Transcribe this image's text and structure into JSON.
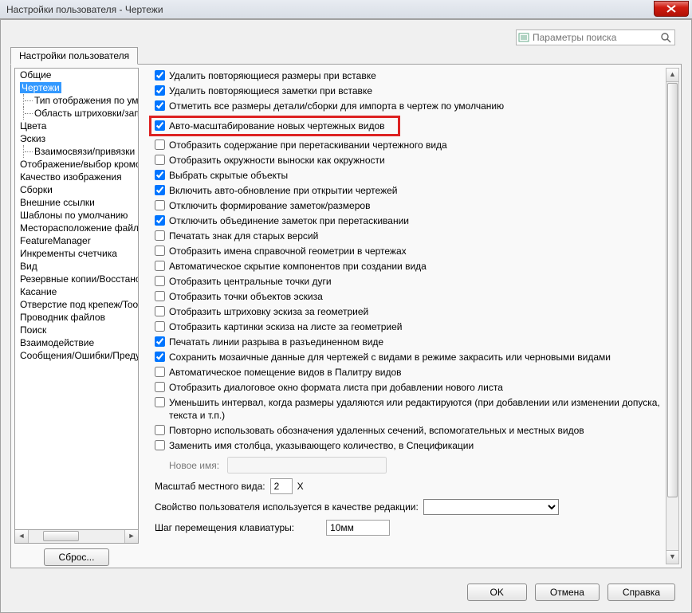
{
  "title": "Настройки пользователя - Чертежи",
  "search": {
    "placeholder": "Параметры поиска"
  },
  "tab": {
    "label": "Настройки пользователя"
  },
  "tree": {
    "items": [
      {
        "label": "Общие",
        "level": 0
      },
      {
        "label": "Чертежи",
        "level": 0,
        "selected": true
      },
      {
        "label": "Тип отображения по умо",
        "level": 1
      },
      {
        "label": "Область штриховки/зап",
        "level": 1
      },
      {
        "label": "Цвета",
        "level": 0
      },
      {
        "label": "Эскиз",
        "level": 0
      },
      {
        "label": "Взаимосвязи/привязки",
        "level": 1
      },
      {
        "label": "Отображение/выбор кромо",
        "level": 0
      },
      {
        "label": "Качество изображения",
        "level": 0
      },
      {
        "label": "Сборки",
        "level": 0
      },
      {
        "label": "Внешние ссылки",
        "level": 0
      },
      {
        "label": "Шаблоны по умолчанию",
        "level": 0
      },
      {
        "label": "Месторасположение файло",
        "level": 0
      },
      {
        "label": "FeatureManager",
        "level": 0
      },
      {
        "label": "Инкременты счетчика",
        "level": 0
      },
      {
        "label": "Вид",
        "level": 0
      },
      {
        "label": "Резервные копии/Восстано",
        "level": 0
      },
      {
        "label": "Касание",
        "level": 0
      },
      {
        "label": "Отверстие под крепеж/Tool",
        "level": 0
      },
      {
        "label": "Проводник файлов",
        "level": 0
      },
      {
        "label": "Поиск",
        "level": 0
      },
      {
        "label": "Взаимодействие",
        "level": 0
      },
      {
        "label": "Сообщения/Ошибки/Преду",
        "level": 0
      }
    ]
  },
  "reset_button": "Сброс...",
  "options": [
    {
      "checked": true,
      "label": "Удалить повторяющиеся размеры при вставке",
      "highlight": false
    },
    {
      "checked": true,
      "label": "Удалить повторяющиеся заметки при вставке",
      "highlight": false
    },
    {
      "checked": true,
      "label": "Отметить все размеры детали/сборки для импорта в чертеж по умолчанию",
      "highlight": false
    },
    {
      "checked": true,
      "label": "Авто-масштабирование новых чертежных видов",
      "highlight": true
    },
    {
      "checked": false,
      "label": "Отобразить содержание при перетаскивании чертежного вида",
      "highlight": false
    },
    {
      "checked": false,
      "label": "Отобразить окружности выноски как окружности",
      "highlight": false
    },
    {
      "checked": true,
      "label": "Выбрать скрытые объекты",
      "highlight": false
    },
    {
      "checked": true,
      "label": "Включить авто-обновление при открытии чертежей",
      "highlight": false
    },
    {
      "checked": false,
      "label": "Отключить формирование заметок/размеров",
      "highlight": false
    },
    {
      "checked": true,
      "label": "Отключить объединение заметок при перетаскивании",
      "highlight": false
    },
    {
      "checked": false,
      "label": "Печатать знак для старых версий",
      "highlight": false
    },
    {
      "checked": false,
      "label": "Отобразить имена справочной геометрии в чертежах",
      "highlight": false
    },
    {
      "checked": false,
      "label": "Автоматическое скрытие компонентов при создании вида",
      "highlight": false
    },
    {
      "checked": false,
      "label": "Отобразить центральные точки дуги",
      "highlight": false
    },
    {
      "checked": false,
      "label": "Отобразить точки объектов эскиза",
      "highlight": false
    },
    {
      "checked": false,
      "label": "Отобразить штриховку эскиза за геометрией",
      "highlight": false
    },
    {
      "checked": false,
      "label": "Отобразить картинки эскиза на листе за геометрией",
      "highlight": false
    },
    {
      "checked": true,
      "label": "Печатать линии разрыва в разъединенном виде",
      "highlight": false
    },
    {
      "checked": true,
      "label": "Сохранить мозаичные данные для чертежей с видами в режиме закрасить или черновыми видами",
      "highlight": false
    },
    {
      "checked": false,
      "label": "Автоматическое помещение видов в Палитру видов",
      "highlight": false
    },
    {
      "checked": false,
      "label": "Отобразить диалоговое окно формата листа при добавлении нового листа",
      "highlight": false
    },
    {
      "checked": false,
      "label": "Уменьшить интервал, когда размеры удаляются или редактируются (при добавлении или изменении допуска, текста и т.п.)",
      "highlight": false
    },
    {
      "checked": false,
      "label": "Повторно использовать обозначения удаленных сечений, вспомогательных и местных видов",
      "highlight": false
    },
    {
      "checked": false,
      "label": "Заменить имя столбца, указывающего количество, в Спецификации",
      "highlight": false
    }
  ],
  "newname_label": "Новое имя:",
  "local_scale": {
    "label": "Масштаб местного вида:",
    "value": "2",
    "suffix": "X"
  },
  "custom_prop": {
    "label": "Свойство пользователя используется в качестве редакции:"
  },
  "kbd_step": {
    "label": "Шаг перемещения клавиатуры:",
    "value": "10мм"
  },
  "footer": {
    "ok": "OK",
    "cancel": "Отмена",
    "help": "Справка"
  }
}
